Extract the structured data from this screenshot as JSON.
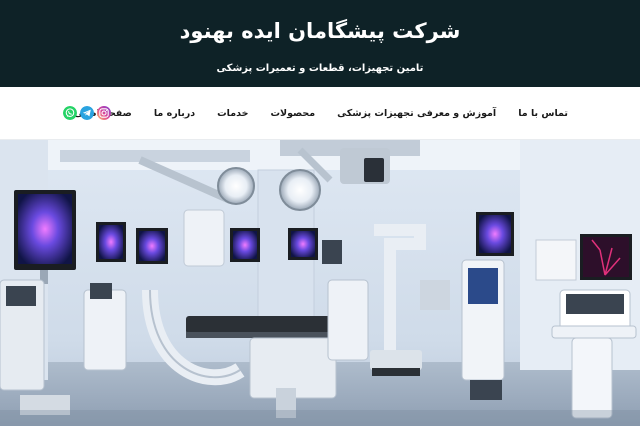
{
  "header": {
    "title": "شرکت پیشگامان ایده بهنود",
    "subtitle": "تامین تجهیزات، قطعات و تعمیرات پزشکی"
  },
  "nav": {
    "items": [
      {
        "id": "home",
        "label": "صفحه اصلی"
      },
      {
        "id": "about",
        "label": "درباره ما"
      },
      {
        "id": "services",
        "label": "خدمات"
      },
      {
        "id": "products",
        "label": "محصولات"
      },
      {
        "id": "training",
        "label": "آموزش و معرفی تجهیزات پزشکی"
      },
      {
        "id": "contact",
        "label": "تماس با ما"
      }
    ]
  },
  "social": {
    "icons": [
      "instagram-icon",
      "telegram-icon",
      "whatsapp-icon"
    ],
    "colors": {
      "instagram": "#d6249f",
      "telegram": "#2aa3e0",
      "whatsapp": "#25d366"
    }
  },
  "hero": {
    "icon": "operating-room-image"
  },
  "colors": {
    "header_bg": "#0e2227",
    "header_text": "#ffffff",
    "nav_text": "#1a1a1a"
  }
}
